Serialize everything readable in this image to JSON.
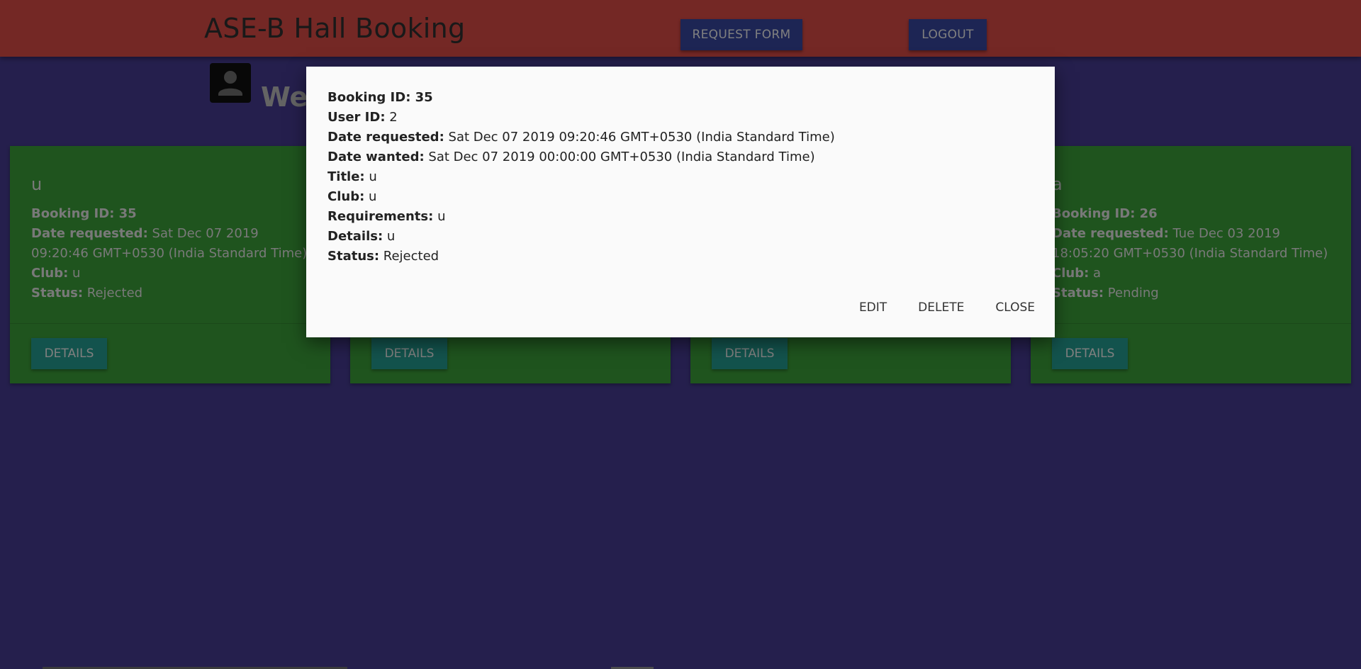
{
  "header": {
    "brand": "ASE-B Hall Booking",
    "request_form_label": "REQUEST FORM",
    "logout_label": "LOGOUT"
  },
  "welcome": {
    "text": "Wel",
    "icon": "account-box-icon"
  },
  "cards": [
    {
      "title": "u",
      "booking_id_label": "Booking ID: 35",
      "date_requested_label": "Date requested:",
      "date_requested": "Sat Dec 07 2019 09:20:46 GMT+0530 (India Standard Time)",
      "club_label": "Club:",
      "club": "u",
      "status_label": "Status:",
      "status": "Rejected",
      "details_label": "DETAILS"
    },
    {
      "title": "",
      "booking_id_label": "",
      "date_requested_label": "",
      "date_requested": "",
      "club_label": "",
      "club": "",
      "status_label": "",
      "status": "",
      "details_label": "DETAILS"
    },
    {
      "title": "",
      "booking_id_label": "",
      "date_requested_label": "",
      "date_requested": "",
      "club_label": "",
      "club": "",
      "status_label": "",
      "status": "",
      "details_label": "DETAILS"
    },
    {
      "title": "a",
      "booking_id_label": "Booking ID: 26",
      "date_requested_label": "Date requested:",
      "date_requested": "Tue Dec 03 2019 18:05:20 GMT+0530 (India Standard Time)",
      "club_label": "Club:",
      "club": "a",
      "status_label": "Status:",
      "status": "Pending",
      "details_label": "DETAILS"
    }
  ],
  "modal": {
    "booking_id_label": "Booking ID: 35",
    "user_id_label": "User ID:",
    "user_id": "2",
    "date_requested_label": "Date requested:",
    "date_requested": "Sat Dec 07 2019 09:20:46 GMT+0530 (India Standard Time)",
    "date_wanted_label": "Date wanted:",
    "date_wanted": "Sat Dec 07 2019 00:00:00 GMT+0530 (India Standard Time)",
    "title_label": "Title:",
    "title": "u",
    "club_label": "Club:",
    "club": "u",
    "requirements_label": "Requirements:",
    "requirements": "u",
    "details_label": "Details:",
    "details": "u",
    "status_label": "Status:",
    "status": "Rejected",
    "edit_label": "EDIT",
    "delete_label": "DELETE",
    "close_label": "CLOSE"
  },
  "colors": {
    "header": "#e8504b",
    "background": "#4a3f9a",
    "card": "#3fa83c",
    "card_button": "#26a69a",
    "header_button": "#3b4aa8"
  }
}
